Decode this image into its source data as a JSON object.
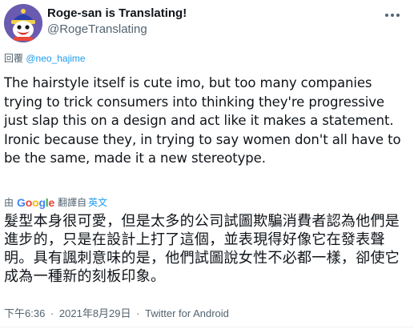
{
  "author": {
    "display_name": "Roge-san is Translating!",
    "handle": "@RogeTranslating"
  },
  "reply_to": {
    "prefix": "回覆",
    "mention": "@neo_hajime"
  },
  "tweet": {
    "text": "The hairstyle itself is cute imo, but too many companies trying to trick consumers into thinking they're progressive just slap this on a design and act like it makes a statement. Ironic because they, in trying to say women don't all have to be the same, made it a new stereotype."
  },
  "translation": {
    "by": "由",
    "google": [
      "G",
      "o",
      "o",
      "g",
      "l",
      "e"
    ],
    "action": "翻譯自",
    "language": "英文",
    "text": "髮型本身很可愛，但是太多的公司試圖欺騙消費者認為他們是進步的，只是在設計上打了這個，並表現得好像它在發表聲明。具有諷刺意味的是，他們試圖說女性不必都一樣，卻使它成為一種新的刻板印象。"
  },
  "meta": {
    "time": "下午6:36",
    "separator": "·",
    "date": "2021年8月29日",
    "source": "Twitter for Android"
  },
  "colors": {
    "text": "#0f1419",
    "secondary": "#536471",
    "link": "#1d9bf0",
    "avatar_bg": "#6a5bb0"
  },
  "icons": {
    "avatar": "frost-mascot-avatar",
    "more": "more-horizontal-icon"
  }
}
